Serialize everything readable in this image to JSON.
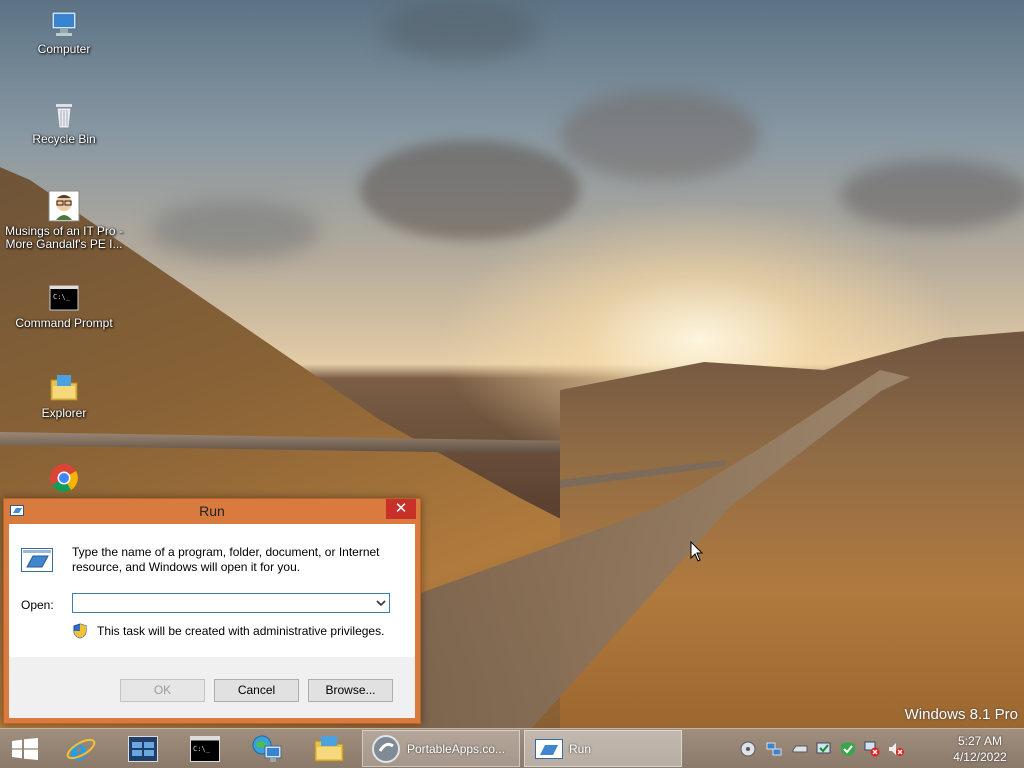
{
  "desktop": {
    "icons": [
      {
        "name": "computer",
        "label": "Computer"
      },
      {
        "name": "recycle-bin",
        "label": "Recycle Bin"
      },
      {
        "name": "musings",
        "label_line1": "Musings of an IT Pro -",
        "label_line2": "More Gandalf's PE I..."
      },
      {
        "name": "command-prompt",
        "label": "Command Prompt"
      },
      {
        "name": "explorer",
        "label": "Explorer"
      },
      {
        "name": "chrome",
        "label": ""
      }
    ],
    "watermark": "Windows 8.1 Pro"
  },
  "run_dialog": {
    "title": "Run",
    "close_glyph": "✕",
    "description": "Type the name of a program, folder, document, or Internet resource, and Windows will open it for you.",
    "open_label": "Open:",
    "open_value": "",
    "admin_note": "This task will be created with administrative privileges.",
    "ok_label": "OK",
    "cancel_label": "Cancel",
    "browse_label": "Browse..."
  },
  "taskbar": {
    "items": [
      {
        "name": "start",
        "icon": "windows-logo-icon"
      },
      {
        "name": "internet-explorer",
        "icon": "ie-icon"
      },
      {
        "name": "task-manager",
        "icon": "task-manager-icon"
      },
      {
        "name": "command-prompt",
        "icon": "cmd-icon"
      },
      {
        "name": "network",
        "icon": "globe-monitor-icon"
      },
      {
        "name": "file-explorer",
        "icon": "folder-icon"
      },
      {
        "name": "portableapps",
        "label": "PortableApps.co...",
        "icon": "portableapps-icon"
      },
      {
        "name": "run",
        "label": "Run",
        "icon": "run-icon"
      }
    ],
    "clock": {
      "time": "5:27 AM",
      "date": "4/12/2022"
    }
  },
  "colors": {
    "window_frame": "#d97b3e",
    "close_button": "#c7312a",
    "taskbar": "#9a887a"
  }
}
